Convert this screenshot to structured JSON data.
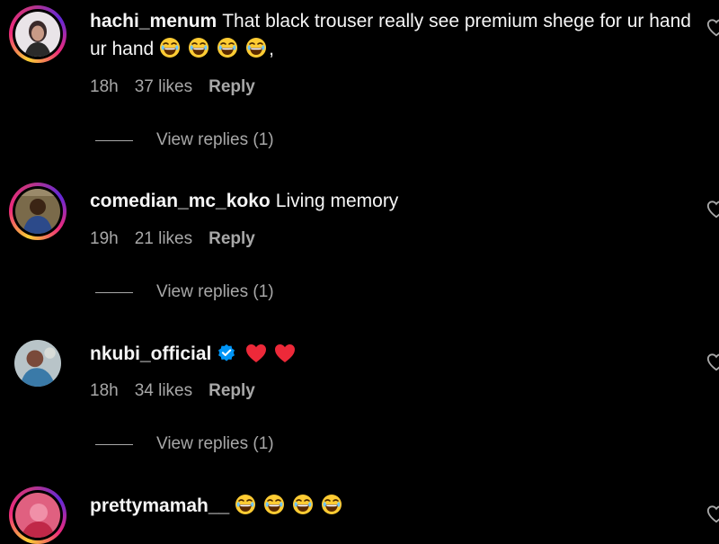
{
  "comments": [
    {
      "username": "hachi_menum",
      "text": "That black trouser really see premium shege for ur hand",
      "suffix": ",",
      "time": "18h",
      "likes": "37 likes",
      "reply_label": "Reply",
      "view_replies": "View replies (1)"
    },
    {
      "username": "comedian_mc_koko",
      "text": "Living memory",
      "time": "19h",
      "likes": "21 likes",
      "reply_label": "Reply",
      "view_replies": "View replies (1)"
    },
    {
      "username": "nkubi_official",
      "text": "",
      "time": "18h",
      "likes": "34 likes",
      "reply_label": "Reply",
      "view_replies": "View replies (1)"
    },
    {
      "username": "prettymamah__",
      "text": ""
    }
  ],
  "icons": {
    "emoji": "laughing-emoji",
    "heart": "red-heart-emoji",
    "verified": "verified-badge-icon",
    "like": "heart-outline-icon"
  },
  "colors": {
    "background": "#000000",
    "text": "#f5f5f5",
    "meta": "#a8a8a8",
    "verified": "#0095f6",
    "heart": "#ed2939"
  }
}
